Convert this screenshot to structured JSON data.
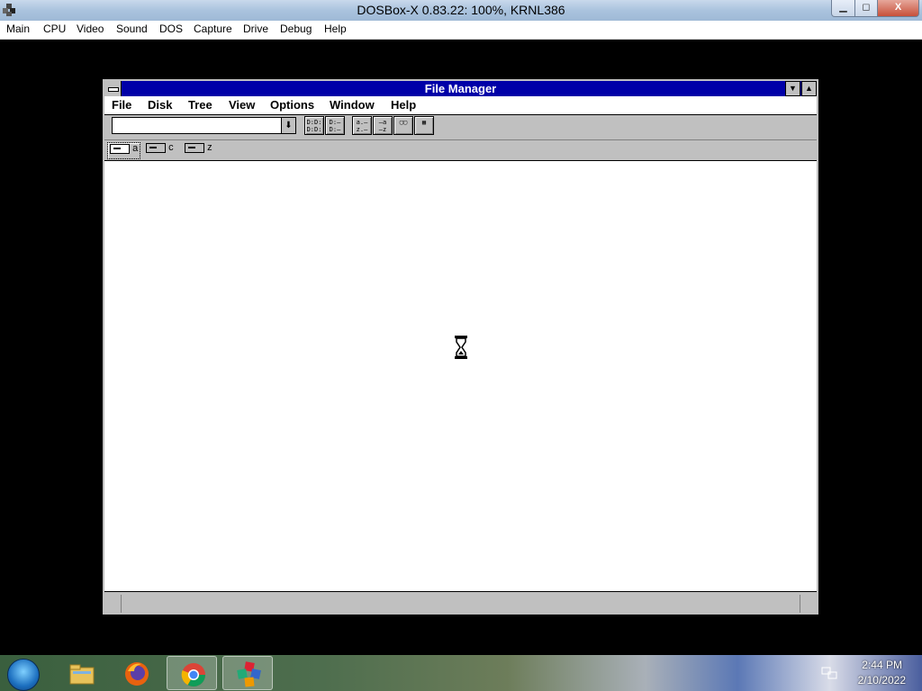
{
  "host_window": {
    "title": "DOSBox-X 0.83.22: 100%, KRNL386",
    "min_label": "▁",
    "max_label": "◻",
    "close_label": "X"
  },
  "host_menu": [
    "Main",
    "CPU",
    "Video",
    "Sound",
    "DOS",
    "Capture",
    "Drive",
    "Debug",
    "Help"
  ],
  "file_manager": {
    "title": "File Manager",
    "menu": [
      "File",
      "Disk",
      "Tree",
      "View",
      "Options",
      "Window",
      "Help"
    ],
    "drive_combo_value": "",
    "toolbar_buttons": [
      {
        "name": "connect-drive-button",
        "glyph": "D:D:\nD:D:"
      },
      {
        "name": "disconnect-drive-button",
        "glyph": "D:—\nD:—"
      },
      {
        "name": "view-details-button",
        "glyph": "a.—\nz.—"
      },
      {
        "name": "sort-by-name-button",
        "glyph": "—a\n—z"
      },
      {
        "name": "sort-by-type-button",
        "glyph": "▢▢"
      },
      {
        "name": "sort-by-size-button",
        "glyph": "▦"
      }
    ],
    "drives": [
      {
        "letter": "a",
        "selected": true
      },
      {
        "letter": "c",
        "selected": false
      },
      {
        "letter": "z",
        "selected": false
      }
    ],
    "cursor": "hourglass-icon"
  },
  "taskbar": {
    "items": [
      "start-orb",
      "file-explorer",
      "firefox",
      "chrome",
      "dosbox"
    ],
    "clock_time": "2:44 PM",
    "clock_date": "2/10/2022"
  },
  "colors": {
    "fm_titlebar": "#0000a8",
    "win31_face": "#c0c0c0"
  }
}
